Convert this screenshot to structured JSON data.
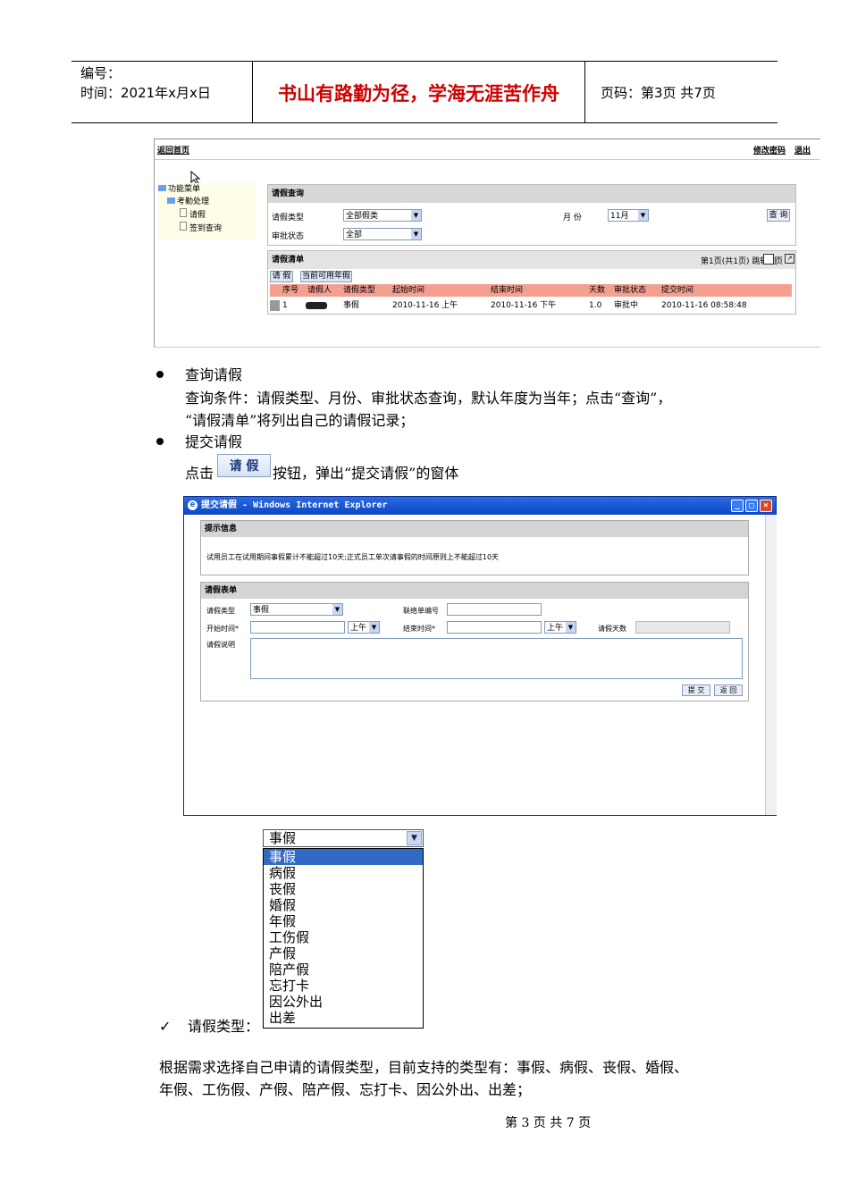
{
  "header": {
    "serial_label": "编号：",
    "date_label": "时间：2021年x月x日",
    "motto": "书山有路勤为径，学海无涯苦作舟",
    "page_label": "页码：第3页  共7页"
  },
  "screen1": {
    "back_home": "返回首页",
    "change_password": "修改密码",
    "logout": "退出",
    "tree": {
      "root": "功能菜单",
      "group": "考勤处理",
      "leaf1": "请假",
      "leaf2": "签到查询"
    },
    "query": {
      "title": "请假查询",
      "type_label": "请假类型",
      "type_value": "全部假类",
      "month_label": "月 份",
      "month_value": "11月",
      "query_button": "查 询",
      "status_label": "审批状态",
      "status_value": "全部"
    },
    "list": {
      "title": "请假清单",
      "pager": "第1页(共1页) 跳转到",
      "pager_unit": "页",
      "tab_leave": "请 假",
      "tab_annual": "当前可用年假",
      "columns": [
        "序号",
        "请假人",
        "请假类型",
        "起始时间",
        "结束时间",
        "天数",
        "审批状态",
        "提交时间"
      ],
      "rows": [
        [
          "1",
          "",
          "事假",
          "2010-11-16 上午",
          "2010-11-16 下午",
          "1.0",
          "审批中",
          "2010-11-16 08:58:48"
        ]
      ]
    }
  },
  "section1": {
    "heading": "查询请假",
    "line1": "查询条件：请假类型、月份、审批状态查询，默认年度为当年；点击“查询”，",
    "line2": "“请假清单”将列出自己的请假记录；"
  },
  "section2": {
    "heading": "提交请假",
    "click_prefix": "点击",
    "button_image_label": "请 假",
    "click_suffix": "按钮，弹出“提交请假”的窗体"
  },
  "window": {
    "title": "提交请假 - Windows Internet Explorer",
    "notice_title": "提示信息",
    "notice_text": "试用员工在试用期间事假累计不能超过10天;正式员工单次请事假的时间原则上不能超过10天",
    "form_title": "请假表单",
    "type_label": "请假类型",
    "type_value": "事假",
    "contact_label": "联络单编号",
    "start_label": "开始时间*",
    "start_half": "上午",
    "end_label": "结束时间*",
    "end_half": "上午",
    "days_label": "请假天数",
    "desc_label": "请假说明",
    "submit_button": "提 交",
    "back_button": "返 回"
  },
  "dropdown": {
    "selected": "事假",
    "options": [
      "事假",
      "病假",
      "丧假",
      "婚假",
      "年假",
      "工伤假",
      "产假",
      "陪产假",
      "忘打卡",
      "因公外出",
      "出差"
    ],
    "highlight_color": "#316ac5"
  },
  "section3": {
    "check_label": "请假类型：",
    "para_line1": "根据需求选择自己申请的请假类型，目前支持的类型有：事假、病假、丧假、婚假、",
    "para_line2": "年假、工伤假、产假、陪产假、忘打卡、因公外出、出差；"
  },
  "footer": {
    "page": "第 3 页 共 7 页"
  }
}
